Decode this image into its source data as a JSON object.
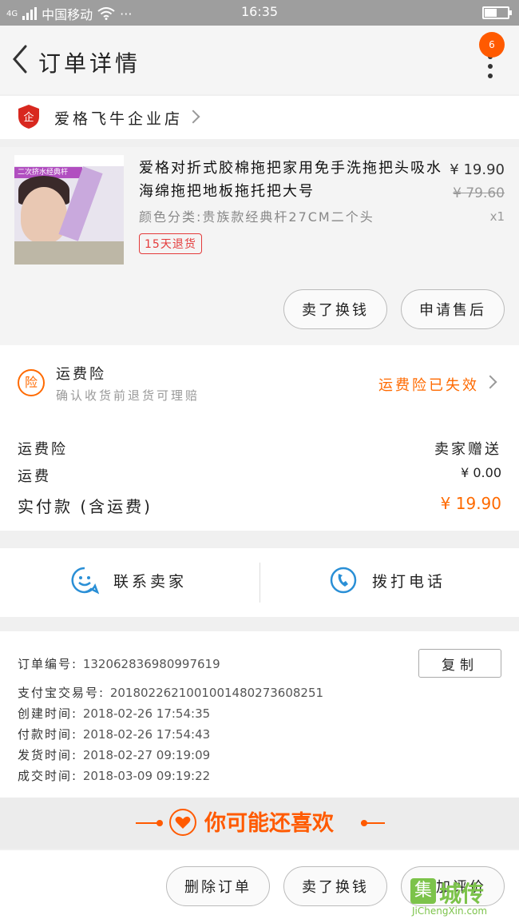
{
  "status_bar": {
    "carrier": "中国移动",
    "network": "4G",
    "time": "16:35",
    "dots": "···",
    "battery_level": 0.55
  },
  "nav": {
    "title": "订单详情",
    "badge_count": "6"
  },
  "store": {
    "name": "爱格飞牛企业店",
    "icon_text": "企"
  },
  "product": {
    "title": "爱格对折式胶棉拖把家用免手洗拖把头吸水海绵拖把地板拖托把大号",
    "sku": "颜色分类:贵族款经典杆27CM二个头",
    "refund_tag": "15天退货",
    "price": "¥ 19.90",
    "original_price": "¥ 79.60",
    "quantity": "x1",
    "image_banner": "二次挤水经典杆",
    "buttons": {
      "buy_again": "卖了换钱",
      "after_sale": "申请售后"
    }
  },
  "insurance": {
    "icon_text": "险",
    "title": "运费险",
    "subtitle": "确认收货前退货可理赔",
    "status": "运费险已失效"
  },
  "fees": {
    "insurance_label": "运费险",
    "insurance_value": "卖家赠送",
    "shipping_label": "运费",
    "shipping_value": "¥ 0.00",
    "paid_label": "实付款 (含运费)",
    "paid_value": "¥ 19.90"
  },
  "contact": {
    "seller_label": "联系卖家",
    "phone_label": "拨打电话"
  },
  "order": {
    "order_no_label": "订单编号:",
    "order_no": "132062836980997619",
    "alipay_label": "支付宝交易号:",
    "alipay_no": "2018022621001001480273608251",
    "created_label": "创建时间:",
    "created": "2018-02-26 17:54:35",
    "paid_label": "付款时间:",
    "paid": "2018-02-26 17:54:43",
    "shipped_label": "发货时间:",
    "shipped": "2018-02-27 09:19:09",
    "completed_label": "成交时间:",
    "completed": "2018-03-09 09:19:22",
    "copy_label": "复制"
  },
  "recommend": {
    "title": "你可能还喜欢"
  },
  "bottom": {
    "delete_label": "删除订单",
    "sell_label": "卖了换钱",
    "review_label": "追加评价"
  },
  "watermark": {
    "logo_char": "集",
    "name": "城传",
    "url": "JiChengXin.com"
  },
  "colors": {
    "accent": "#ff5a00",
    "insurance": "#ff6a00",
    "refund": "#e43a3a",
    "contact_icon": "#2a8fd6"
  }
}
